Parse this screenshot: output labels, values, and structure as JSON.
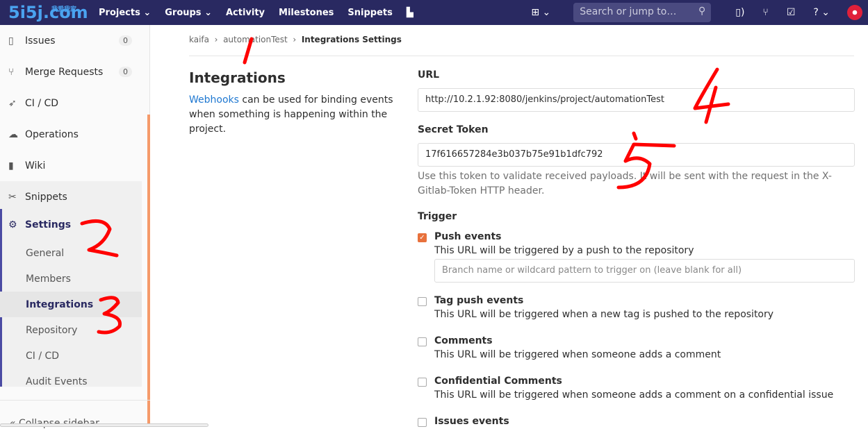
{
  "nav": {
    "logo": "5i5j.com",
    "logo_sub": "我爱我家",
    "items": [
      "Projects ⌄",
      "Groups ⌄",
      "Activity",
      "Milestones",
      "Snippets"
    ],
    "search_placeholder": "Search or jump to…"
  },
  "sidebar": {
    "items": [
      {
        "label": "Issues",
        "badge": "0",
        "icon": "issues-icon"
      },
      {
        "label": "Merge Requests",
        "badge": "0",
        "icon": "merge-request-icon"
      },
      {
        "label": "CI / CD",
        "icon": "rocket-icon"
      },
      {
        "label": "Operations",
        "icon": "cloud-gear-icon"
      },
      {
        "label": "Wiki",
        "icon": "book-icon"
      },
      {
        "label": "Snippets",
        "icon": "scissors-icon"
      }
    ],
    "settings": {
      "label": "Settings",
      "subitems": [
        "General",
        "Members",
        "Integrations",
        "Repository",
        "CI / CD",
        "Audit Events"
      ],
      "active": "Integrations"
    },
    "collapse": "Collapse sidebar"
  },
  "breadcrumb": [
    "kaifa",
    "automationTest",
    "Integrations Settings"
  ],
  "section": {
    "title": "Integrations",
    "link": "Webhooks",
    "desc": " can be used for binding events when something is happening within the project."
  },
  "form": {
    "url_label": "URL",
    "url_value": "http://10.2.1.92:8080/jenkins/project/automationTest",
    "token_label": "Secret Token",
    "token_value": "17f616657284e3b037b75e91b1dfc792",
    "token_help": "Use this token to validate received payloads. It will be sent with the request in the X-Gitlab-Token HTTP header.",
    "trigger_label": "Trigger",
    "branch_placeholder": "Branch name or wildcard pattern to trigger on (leave blank for all)",
    "triggers": [
      {
        "title": "Push events",
        "desc": "This URL will be triggered by a push to the repository",
        "checked": true
      },
      {
        "title": "Tag push events",
        "desc": "This URL will be triggered when a new tag is pushed to the repository",
        "checked": false
      },
      {
        "title": "Comments",
        "desc": "This URL will be triggered when someone adds a comment",
        "checked": false
      },
      {
        "title": "Confidential Comments",
        "desc": "This URL will be triggered when someone adds a comment on a confidential issue",
        "checked": false
      },
      {
        "title": "Issues events",
        "desc": "",
        "checked": false
      }
    ]
  },
  "annotations": [
    "1",
    "2",
    "3",
    "4",
    "5"
  ],
  "colors": {
    "nav": "#292961",
    "accent": "#e8713c",
    "annotation": "#ff0000",
    "link": "#1f78d1"
  }
}
